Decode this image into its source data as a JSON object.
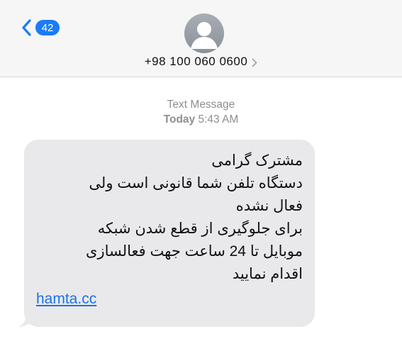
{
  "header": {
    "back_count": "42",
    "contact_number": "+98 100 060 0600",
    "icons": {
      "back": "chevron-left-icon",
      "avatar": "person-avatar-icon",
      "contact_chevron": "chevron-right-icon"
    }
  },
  "thread": {
    "service_label": "Text Message",
    "day": "Today",
    "time": "5:43 AM"
  },
  "message": {
    "lines": [
      "مشترک گرامی",
      "دستگاه تلفن شما قانونی است ولی",
      "فعال نشده",
      "برای جلوگیری از قطع شدن شبکه",
      "موبایل تا 24 ساعت جهت فعالسازی",
      "اقدام نمایید"
    ],
    "link": "hamta.cc"
  },
  "colors": {
    "accent": "#1a7cf6",
    "bubble": "#e9e9eb",
    "header_bg": "#f6f6f6",
    "meta_text": "#8e8e93",
    "link": "#1a73e8"
  }
}
